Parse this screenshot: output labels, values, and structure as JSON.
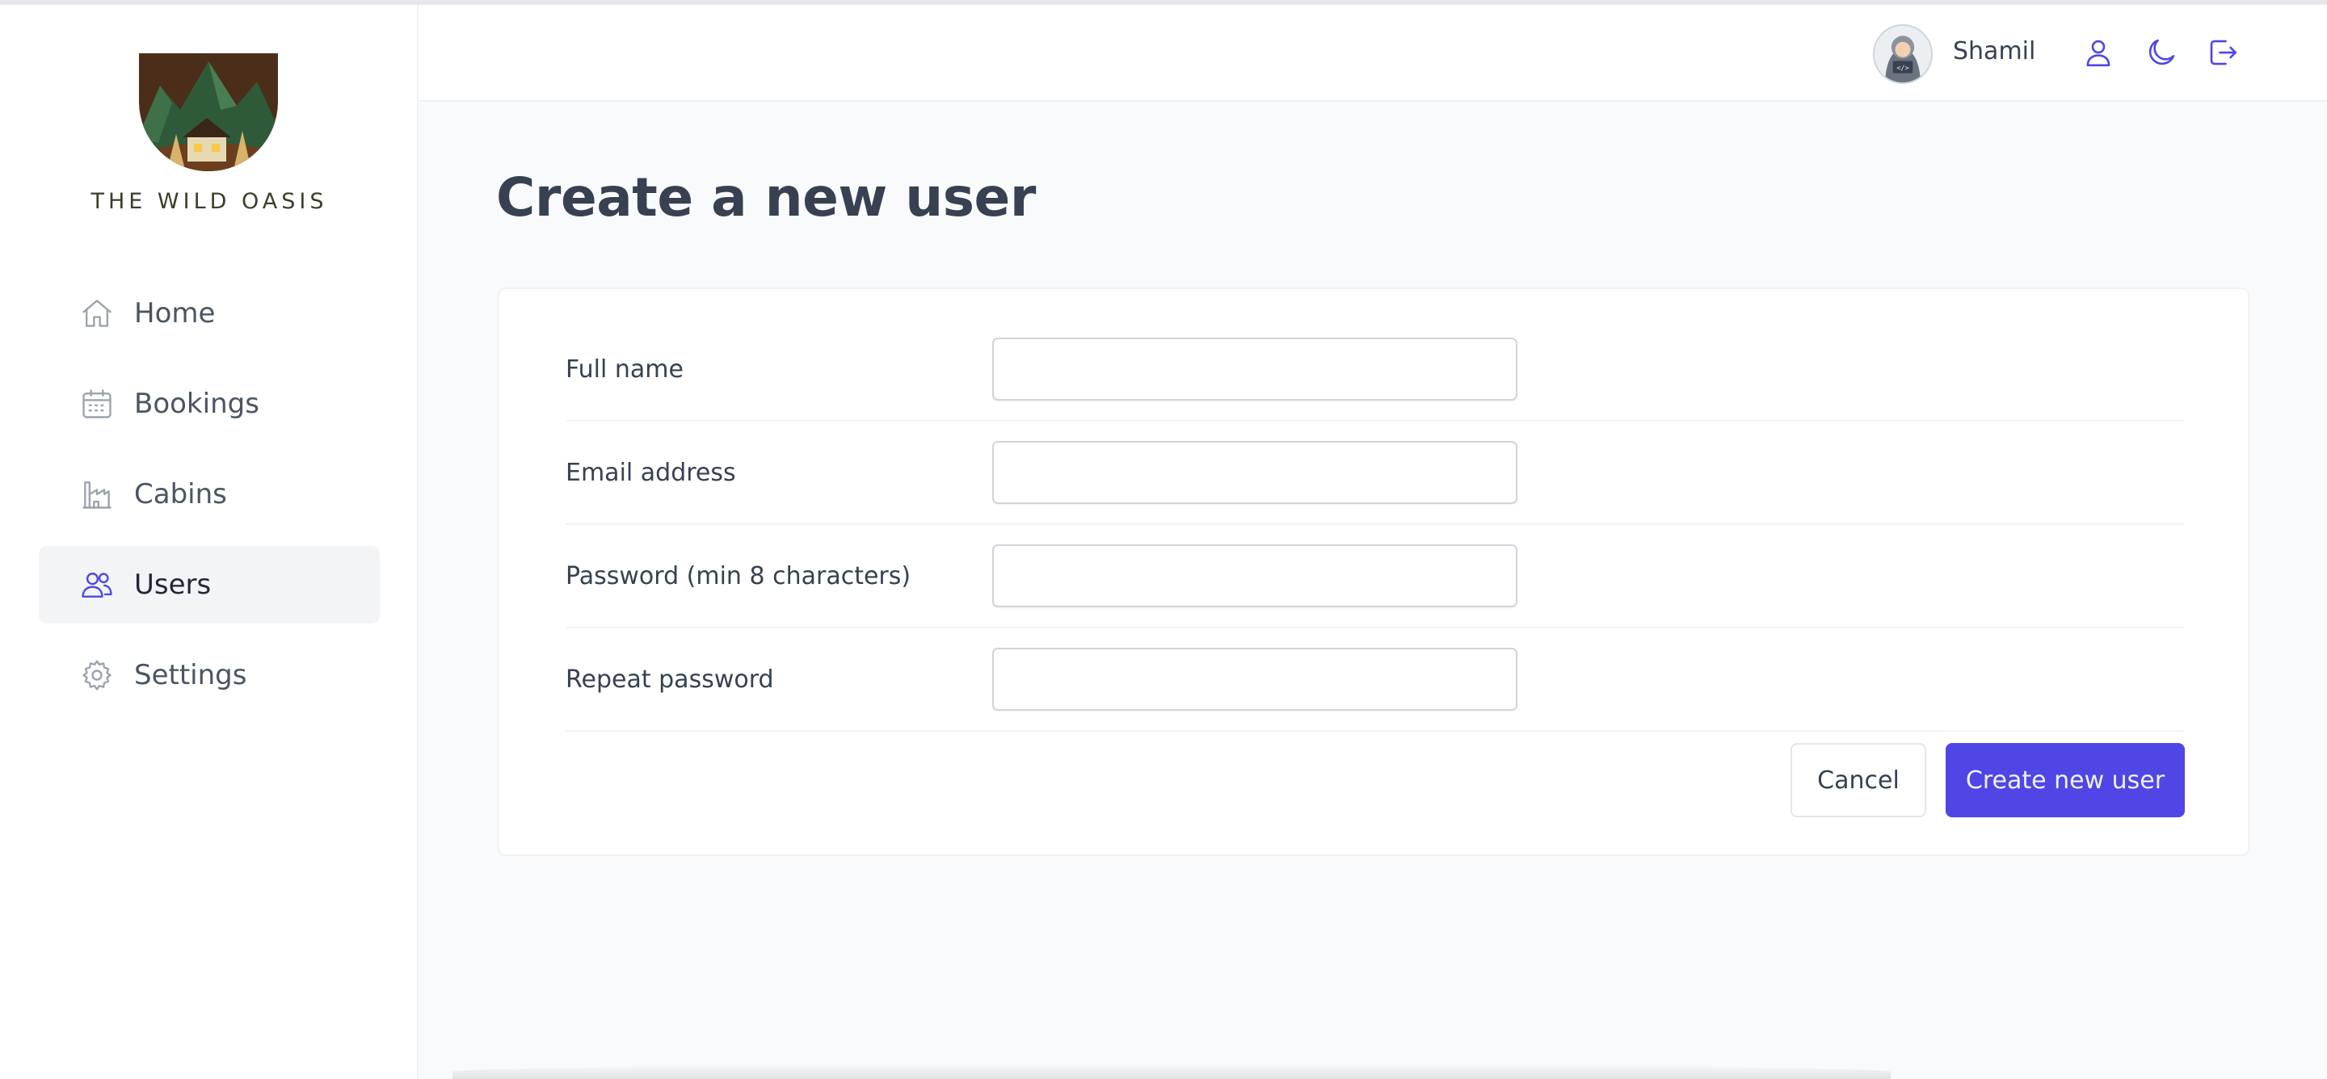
{
  "app": {
    "brand_name": "THE WILD OASIS",
    "logo_icon": "mountain-cabin-logo"
  },
  "sidebar": {
    "items": [
      {
        "label": "Home",
        "icon": "home-icon",
        "active": false
      },
      {
        "label": "Bookings",
        "icon": "calendar-icon",
        "active": false
      },
      {
        "label": "Cabins",
        "icon": "warehouse-icon",
        "active": false
      },
      {
        "label": "Users",
        "icon": "users-icon",
        "active": true
      },
      {
        "label": "Settings",
        "icon": "gear-icon",
        "active": false
      }
    ]
  },
  "header": {
    "username": "Shamil",
    "avatar_icon": "hooded-coder-avatar",
    "buttons": [
      {
        "icon": "user-icon"
      },
      {
        "icon": "moon-icon"
      },
      {
        "icon": "logout-icon"
      }
    ]
  },
  "page": {
    "title": "Create a new user"
  },
  "form": {
    "fields": [
      {
        "label": "Full name",
        "value": ""
      },
      {
        "label": "Email address",
        "value": ""
      },
      {
        "label": "Password (min 8 characters)",
        "value": ""
      },
      {
        "label": "Repeat password",
        "value": ""
      }
    ],
    "cancel_label": "Cancel",
    "submit_label": "Create new user"
  },
  "colors": {
    "accent": "#4f46e5",
    "accent_text": "#eef2ff",
    "icon_accent": "#4f46e5",
    "nav_icon": "#9ca3af",
    "background": "#f9fafb"
  }
}
